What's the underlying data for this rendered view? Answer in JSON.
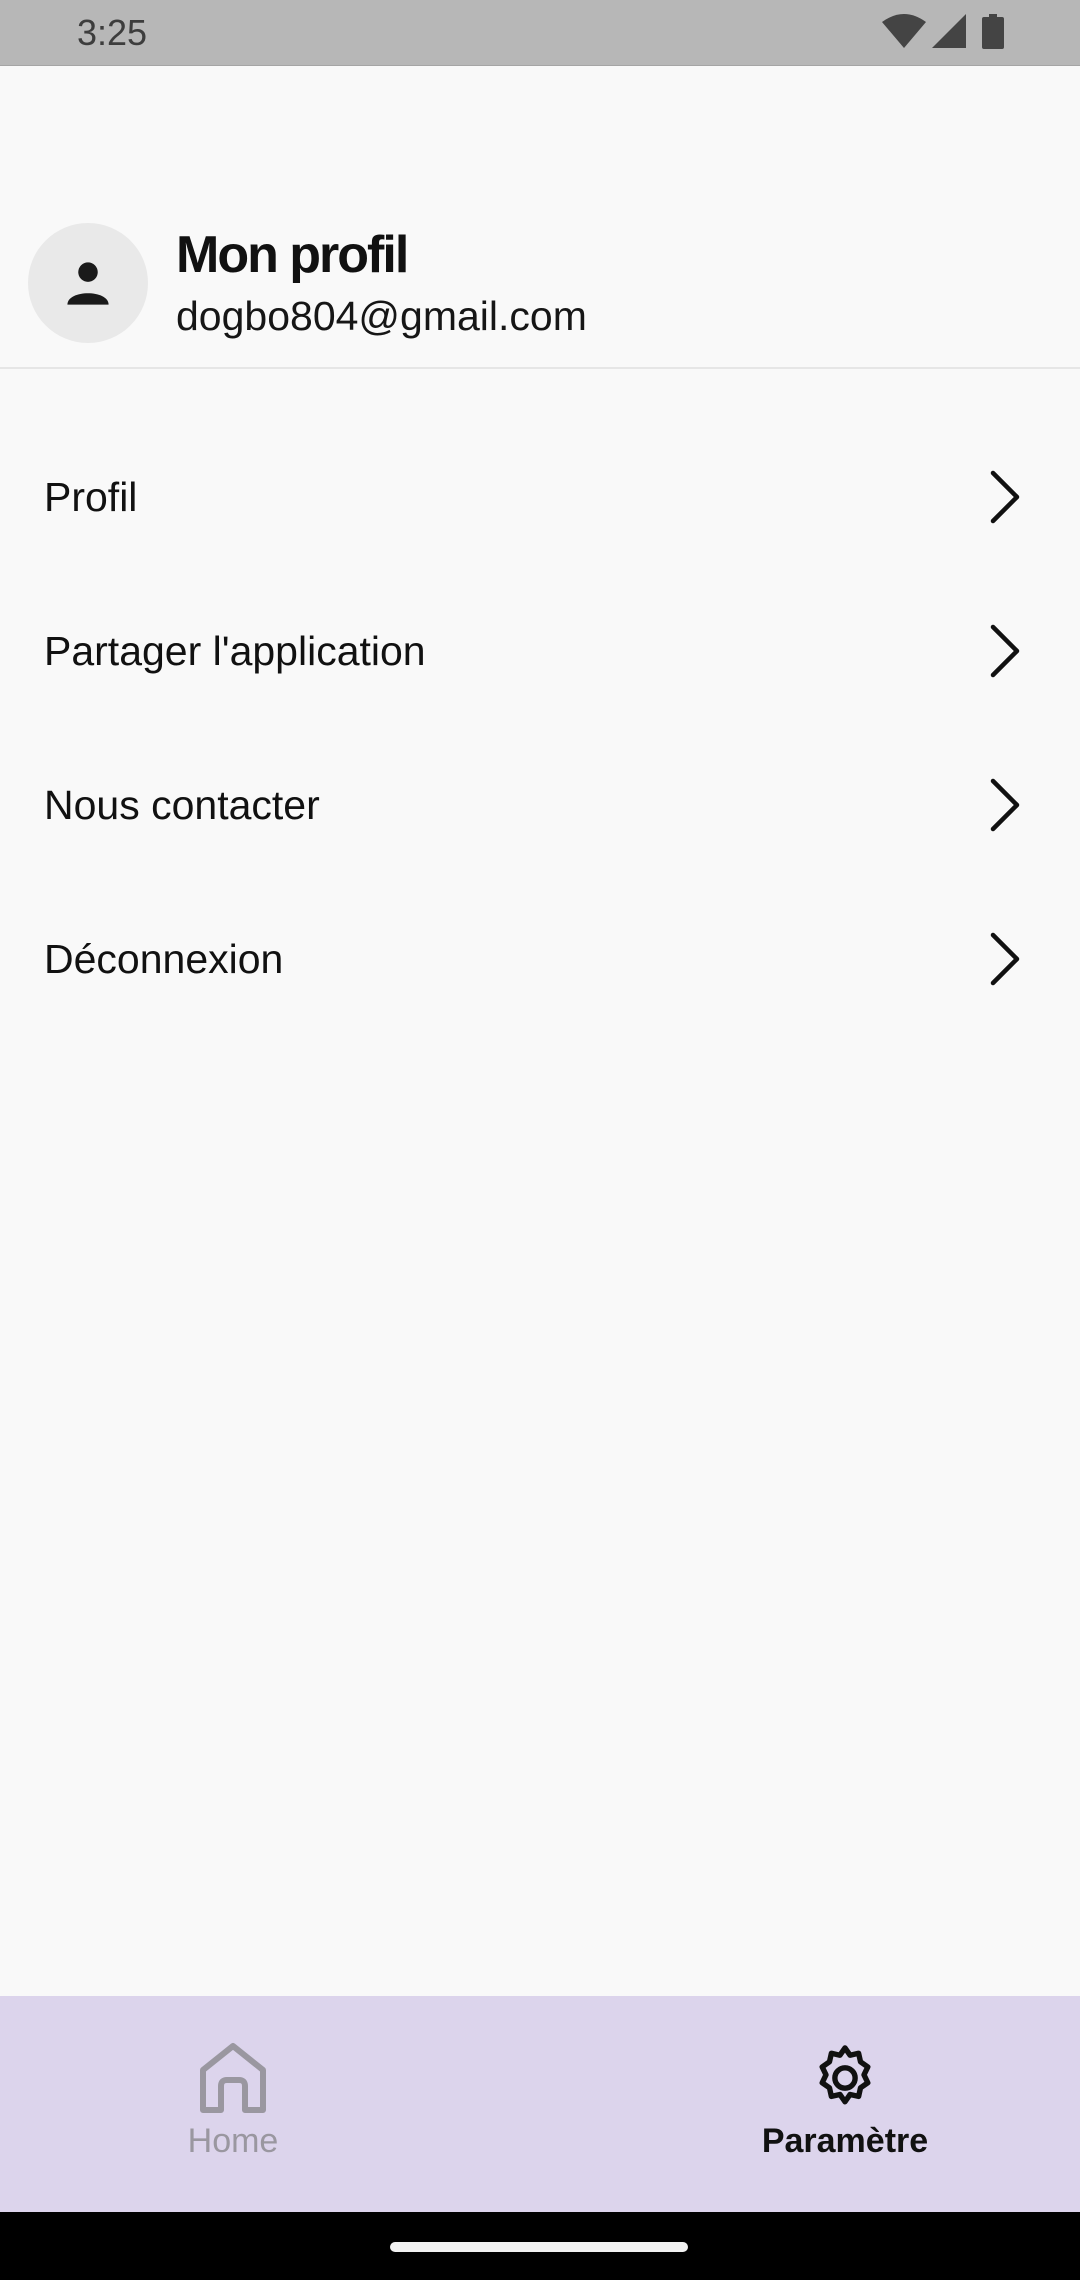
{
  "status_bar": {
    "time": "3:25",
    "icons": [
      "wifi-icon",
      "cell-signal-icon",
      "battery-icon"
    ]
  },
  "profile": {
    "title": "Mon profil",
    "email": "dogbo804@gmail.com",
    "avatar_icon": "person-icon"
  },
  "menu": {
    "items": [
      {
        "label": "Profil",
        "icon": "chevron-right-icon"
      },
      {
        "label": "Partager l'application",
        "icon": "chevron-right-icon"
      },
      {
        "label": "Nous contacter",
        "icon": "chevron-right-icon"
      },
      {
        "label": "Déconnexion",
        "icon": "chevron-right-icon"
      }
    ]
  },
  "bottom_nav": {
    "items": [
      {
        "label": "Home",
        "icon": "home-icon",
        "selected": false
      },
      {
        "label": "Paramètre",
        "icon": "gear-icon",
        "selected": true
      }
    ],
    "background": "#dcd4ec"
  }
}
